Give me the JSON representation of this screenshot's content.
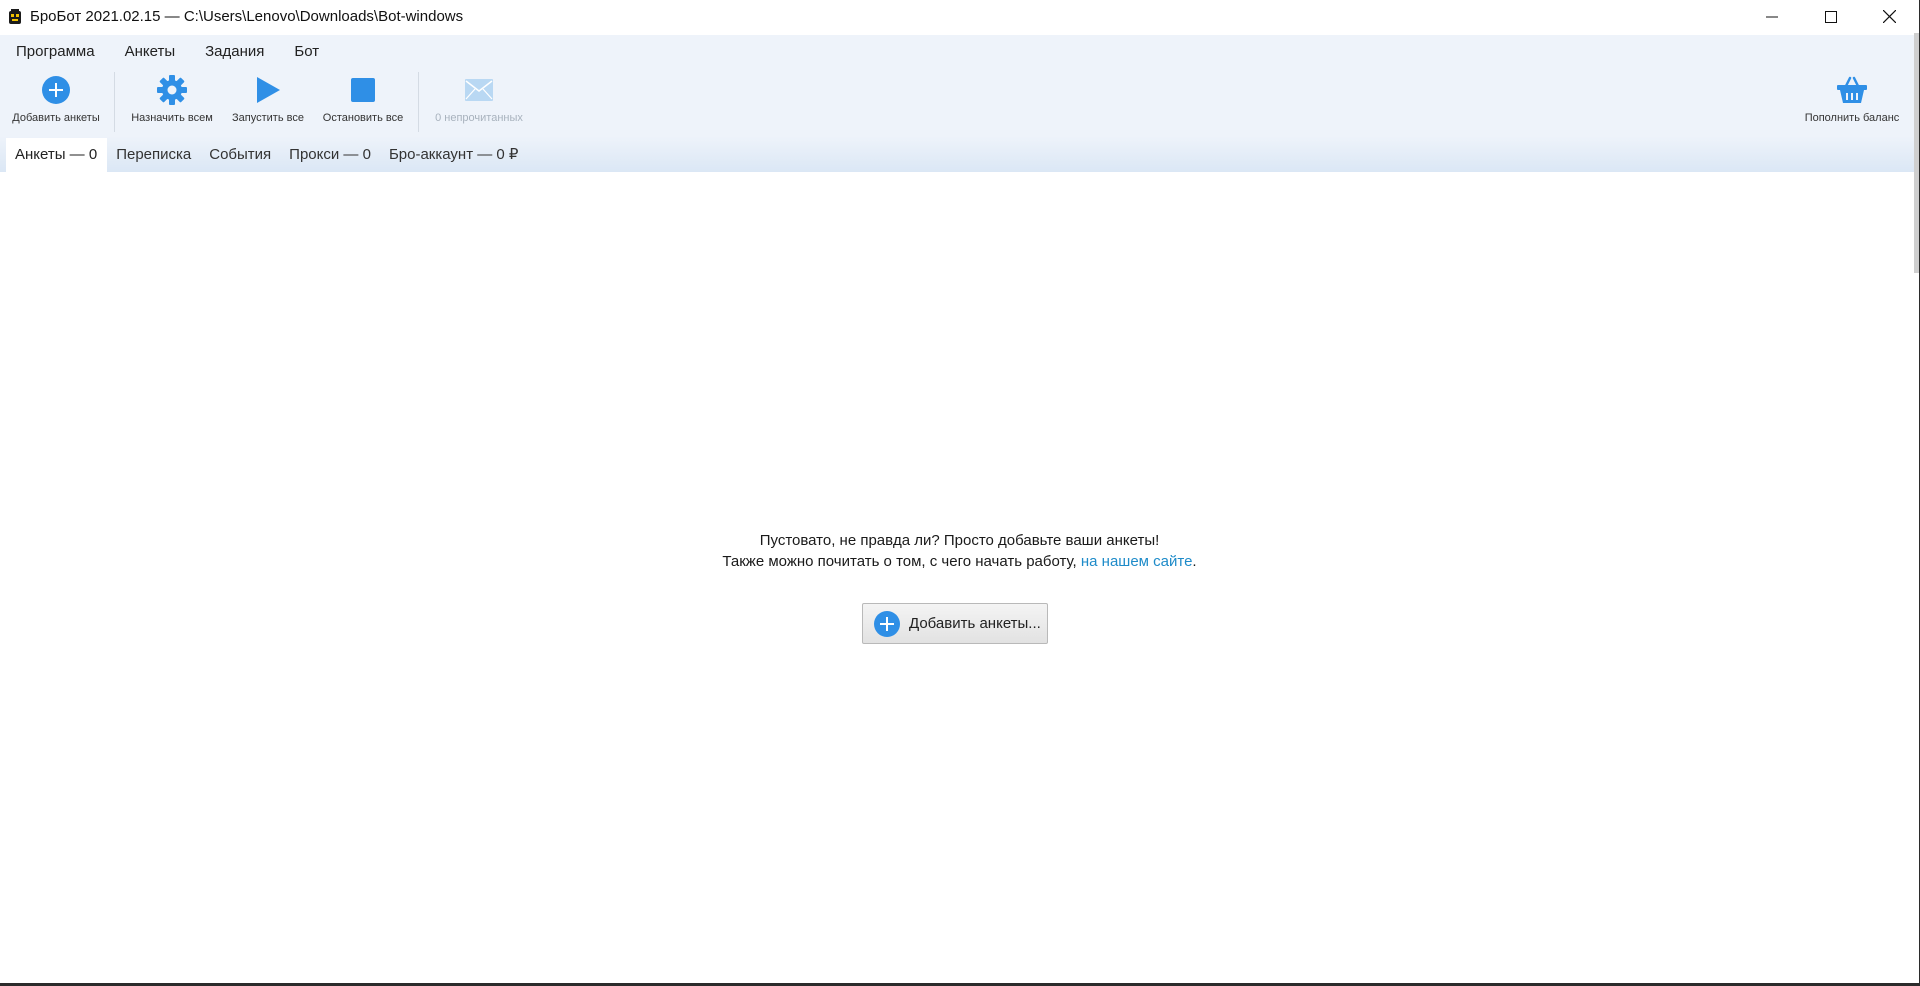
{
  "window": {
    "title": "БроБот 2021.02.15 — C:\\Users\\Lenovo\\Downloads\\Bot-windows",
    "icon": "bot-icon"
  },
  "menu": {
    "items": [
      {
        "label": "Программа"
      },
      {
        "label": "Анкеты"
      },
      {
        "label": "Задания"
      },
      {
        "label": "Бот"
      }
    ]
  },
  "toolbar": {
    "add_forms": {
      "label": "Добавить анкеты",
      "icon": "plus-circle-icon"
    },
    "assign_all": {
      "label": "Назначить всем",
      "icon": "gear-icon"
    },
    "start_all": {
      "label": "Запустить все",
      "icon": "play-icon"
    },
    "stop_all": {
      "label": "Остановить все",
      "icon": "stop-icon"
    },
    "unread": {
      "label": "0 непрочитанных",
      "icon": "envelope-icon"
    },
    "top_up": {
      "label": "Пополнить баланс",
      "icon": "basket-icon"
    }
  },
  "tabs": [
    {
      "label": "Анкеты — 0",
      "active": true
    },
    {
      "label": "Переписка",
      "active": false
    },
    {
      "label": "События",
      "active": false
    },
    {
      "label": "Прокси — 0",
      "active": false
    },
    {
      "label": "Бро-аккаунт — 0 ₽",
      "active": false
    }
  ],
  "empty_state": {
    "line1": "Пустовато, не правда ли? Просто добавьте ваши анкеты!",
    "line2_before": "Также можно почитать о том, с чего начать работу, ",
    "line2_link": "на нашем сайте",
    "line2_after": ".",
    "button_label": "Добавить анкеты..."
  },
  "colors": {
    "accent": "#2f8fe6",
    "link": "#1e8bc9",
    "toolbar_bg": "#eef3fa"
  }
}
